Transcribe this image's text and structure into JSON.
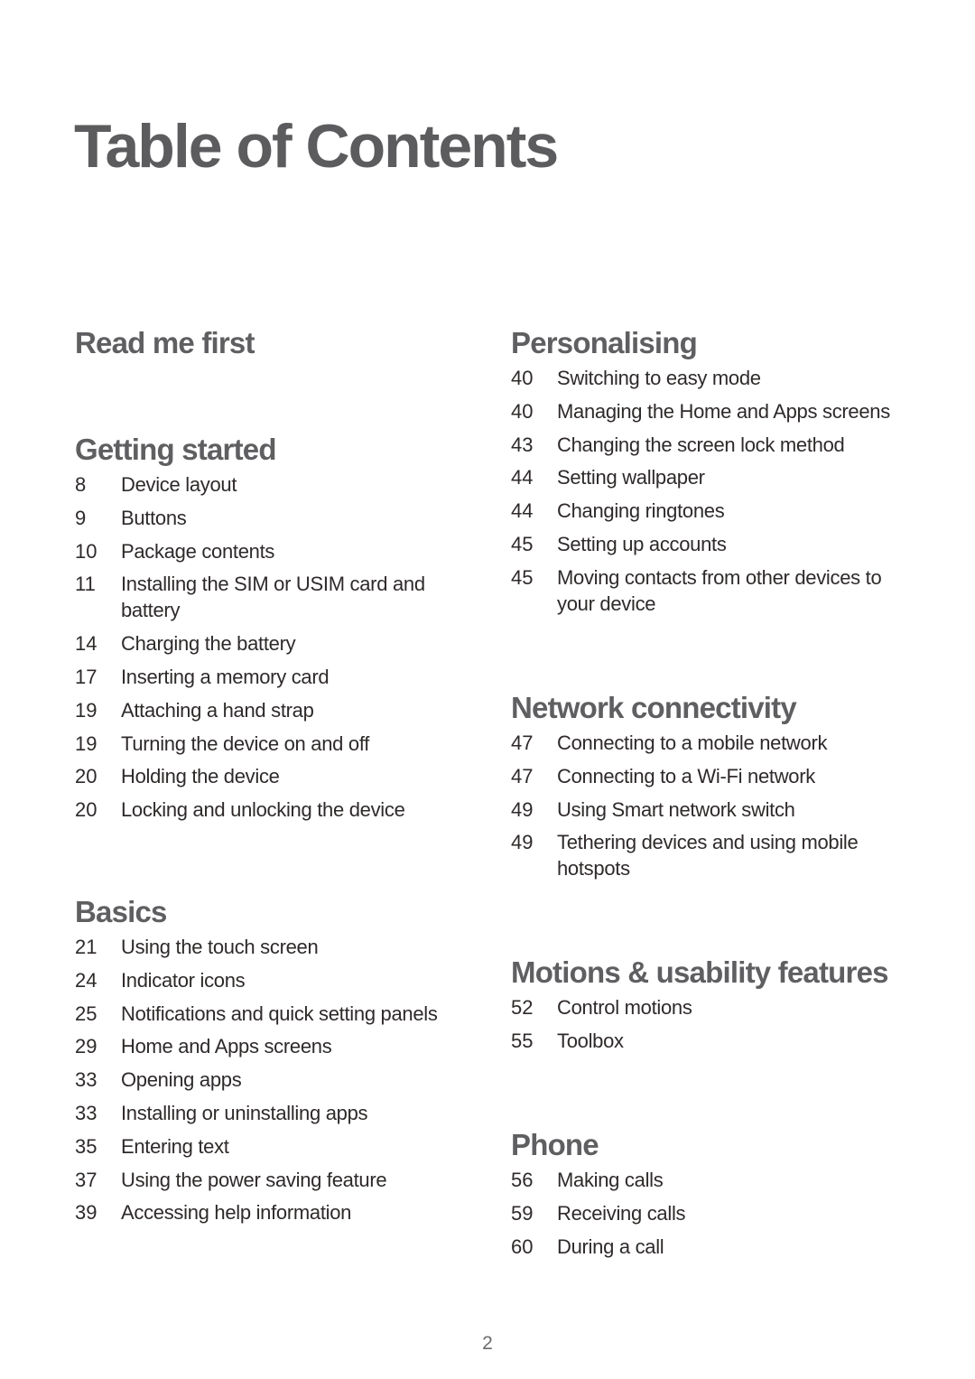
{
  "title": "Table of Contents",
  "page_number": "2",
  "left_column": [
    {
      "heading": "Read me first",
      "entries": []
    },
    {
      "heading": "Getting started",
      "entries": [
        {
          "page": "8",
          "title": "Device layout"
        },
        {
          "page": "9",
          "title": "Buttons"
        },
        {
          "page": "10",
          "title": "Package contents"
        },
        {
          "page": "11",
          "title": "Installing the SIM or USIM card and battery"
        },
        {
          "page": "14",
          "title": "Charging the battery"
        },
        {
          "page": "17",
          "title": "Inserting a memory card"
        },
        {
          "page": "19",
          "title": "Attaching a hand strap"
        },
        {
          "page": "19",
          "title": "Turning the device on and off"
        },
        {
          "page": "20",
          "title": "Holding the device"
        },
        {
          "page": "20",
          "title": "Locking and unlocking the device"
        }
      ]
    },
    {
      "heading": "Basics",
      "entries": [
        {
          "page": "21",
          "title": "Using the touch screen"
        },
        {
          "page": "24",
          "title": "Indicator icons"
        },
        {
          "page": "25",
          "title": "Notifications and quick setting panels"
        },
        {
          "page": "29",
          "title": "Home and Apps screens"
        },
        {
          "page": "33",
          "title": "Opening apps"
        },
        {
          "page": "33",
          "title": "Installing or uninstalling apps"
        },
        {
          "page": "35",
          "title": "Entering text"
        },
        {
          "page": "37",
          "title": "Using the power saving feature"
        },
        {
          "page": "39",
          "title": "Accessing help information"
        }
      ]
    }
  ],
  "right_column": [
    {
      "heading": "Personalising",
      "entries": [
        {
          "page": "40",
          "title": "Switching to easy mode"
        },
        {
          "page": "40",
          "title": "Managing the Home and Apps screens"
        },
        {
          "page": "43",
          "title": "Changing the screen lock method"
        },
        {
          "page": "44",
          "title": "Setting wallpaper"
        },
        {
          "page": "44",
          "title": "Changing ringtones"
        },
        {
          "page": "45",
          "title": "Setting up accounts"
        },
        {
          "page": "45",
          "title": "Moving contacts from other devices to your device"
        }
      ]
    },
    {
      "heading": "Network connectivity",
      "entries": [
        {
          "page": "47",
          "title": "Connecting to a mobile network"
        },
        {
          "page": "47",
          "title": "Connecting to a Wi-Fi network"
        },
        {
          "page": "49",
          "title": "Using Smart network switch"
        },
        {
          "page": "49",
          "title": "Tethering devices and using mobile hotspots"
        }
      ]
    },
    {
      "heading": "Motions & usability features",
      "entries": [
        {
          "page": "52",
          "title": "Control motions"
        },
        {
          "page": "55",
          "title": "Toolbox"
        }
      ]
    },
    {
      "heading": "Phone",
      "entries": [
        {
          "page": "56",
          "title": "Making calls"
        },
        {
          "page": "59",
          "title": "Receiving calls"
        },
        {
          "page": "60",
          "title": "During a call"
        }
      ]
    }
  ]
}
